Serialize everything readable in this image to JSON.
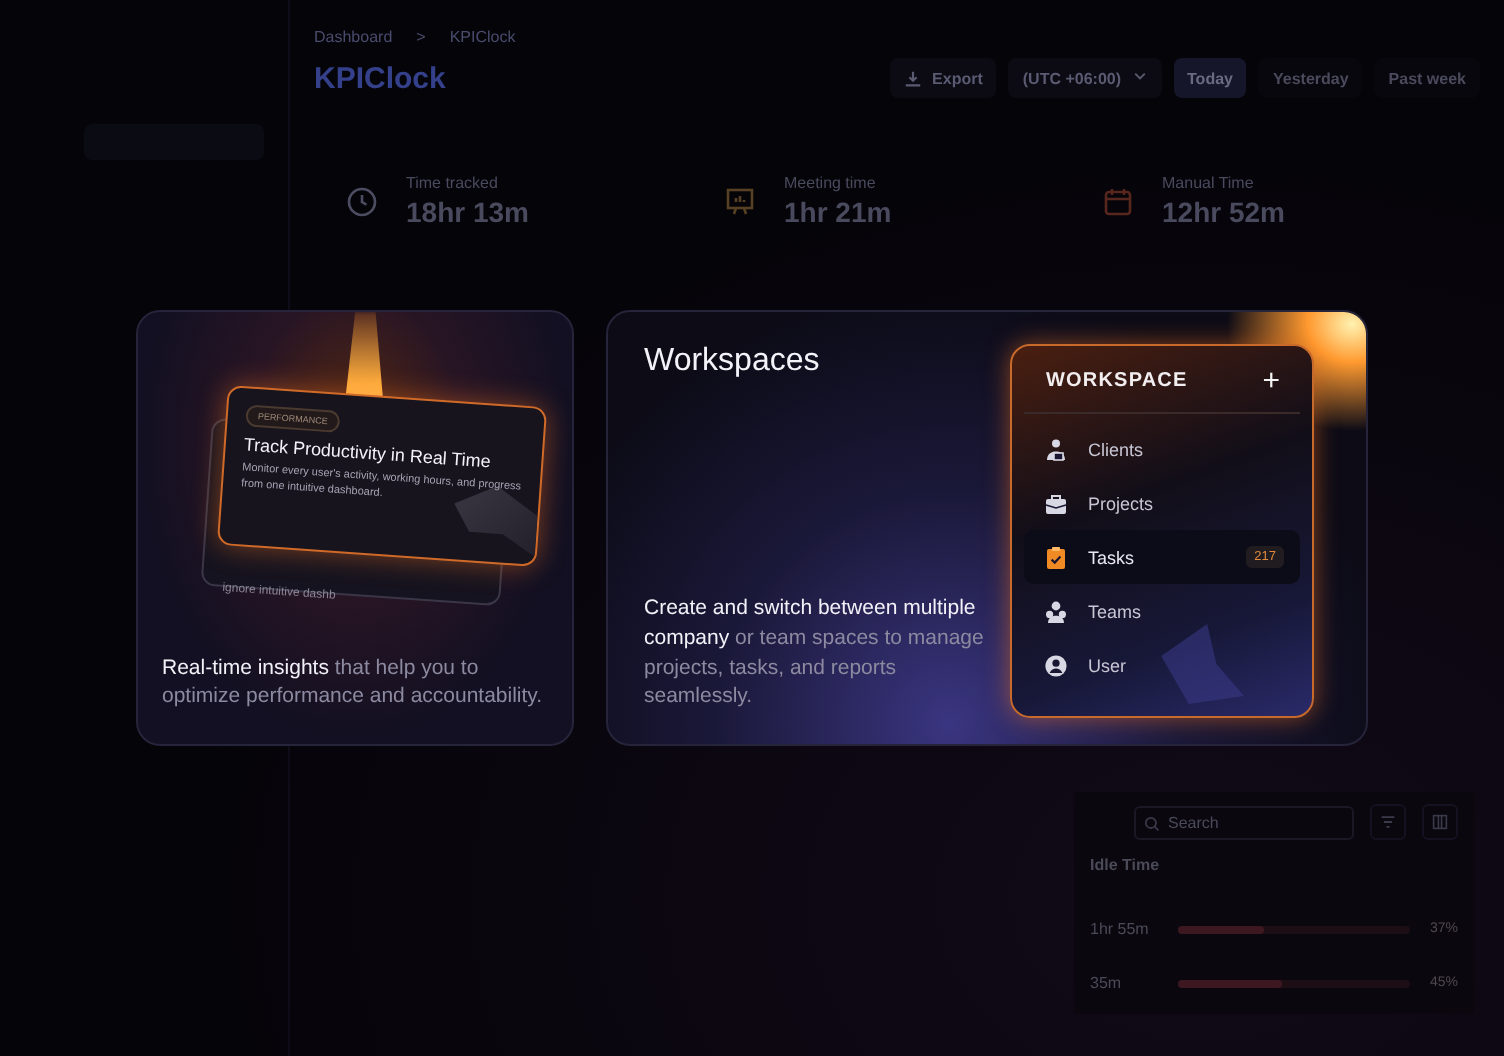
{
  "breadcrumb": {
    "items": [
      "Dashboard",
      "KPIClock"
    ],
    "separator": ">"
  },
  "page_title": "KPIClock",
  "toolbar": {
    "export": "Export",
    "timezone": "(UTC +06:00)",
    "ranges": [
      {
        "label": "Today",
        "selected": true
      },
      {
        "label": "Yesterday",
        "selected": false
      },
      {
        "label": "Past week",
        "selected": false
      }
    ]
  },
  "stats": [
    {
      "kind": "clock",
      "label": "Time tracked",
      "value": "18hr 13m"
    },
    {
      "kind": "meeting",
      "label": "Meeting time",
      "value": "1hr 21m"
    },
    {
      "kind": "calendar",
      "label": "Manual Time",
      "value": "12hr 52m"
    }
  ],
  "table": {
    "search": {
      "placeholder": "Search"
    },
    "column": "Idle Time",
    "rows": [
      {
        "idle": "1hr 55m",
        "level": 0.37,
        "reading": "37%"
      },
      {
        "idle": "35m",
        "level": 0.45,
        "reading": "45%"
      }
    ]
  },
  "feature_cards": [
    {
      "kind": "performance",
      "badge": "PERFORMANCE",
      "title": "Track Productivity in Real Time",
      "body": "Monitor every user's activity, working hours, and progress from one intuitive dashboard.",
      "back_text": "ignore intuitive dashb",
      "caption": "**Real-time insights** that help you to optimize performance and accountability."
    },
    {
      "kind": "workspaces",
      "title": "Workspaces",
      "caption": "**Create and switch between multiple company** or team spaces to manage projects, tasks, and reports seamlessly.",
      "panel": {
        "title": "WORKSPACE",
        "add": "+",
        "items": [
          {
            "kind": "clients",
            "label": "Clients",
            "selected": false
          },
          {
            "kind": "projects",
            "label": "Projects",
            "selected": false
          },
          {
            "kind": "tasks",
            "label": "Tasks",
            "selected": true,
            "count": "217"
          },
          {
            "kind": "teams",
            "label": "Teams",
            "selected": false
          },
          {
            "kind": "user",
            "label": "User",
            "selected": false
          }
        ]
      }
    }
  ]
}
